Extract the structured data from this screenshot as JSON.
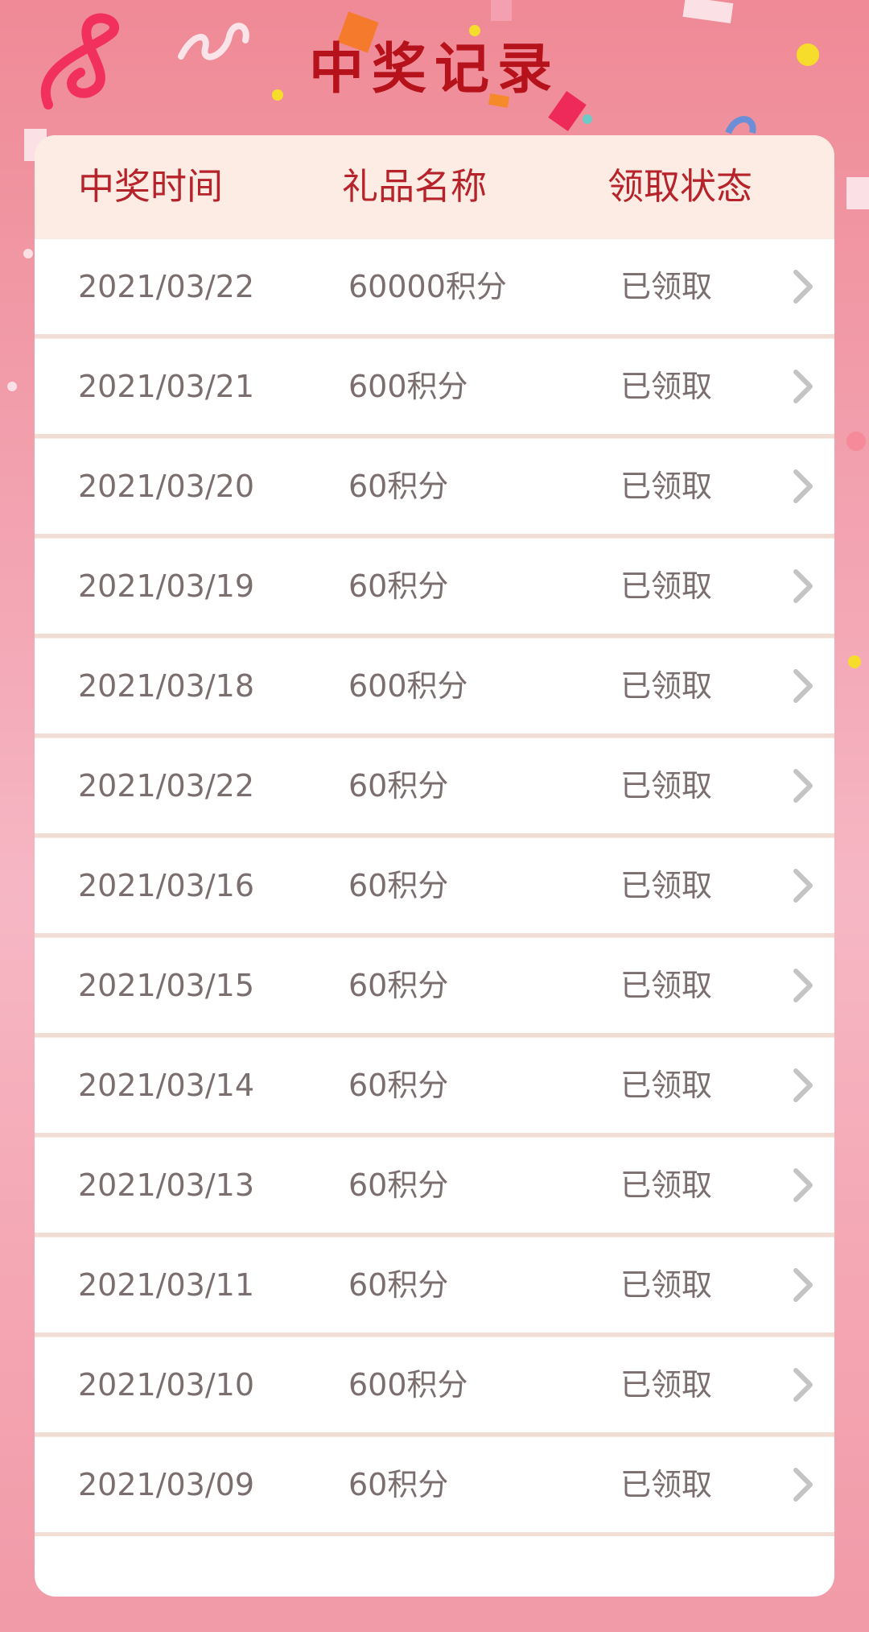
{
  "page": {
    "title": "中奖记录"
  },
  "table": {
    "headers": {
      "time": "中奖时间",
      "gift": "礼品名称",
      "status": "领取状态"
    },
    "rows": [
      {
        "date": "2021/03/22",
        "gift": "60000积分",
        "status": "已领取"
      },
      {
        "date": "2021/03/21",
        "gift": "600积分",
        "status": "已领取"
      },
      {
        "date": "2021/03/20",
        "gift": "60积分",
        "status": "已领取"
      },
      {
        "date": "2021/03/19",
        "gift": "60积分",
        "status": "已领取"
      },
      {
        "date": "2021/03/18",
        "gift": "600积分",
        "status": "已领取"
      },
      {
        "date": "2021/03/22",
        "gift": "60积分",
        "status": "已领取"
      },
      {
        "date": "2021/03/16",
        "gift": "60积分",
        "status": "已领取"
      },
      {
        "date": "2021/03/15",
        "gift": "60积分",
        "status": "已领取"
      },
      {
        "date": "2021/03/14",
        "gift": "60积分",
        "status": "已领取"
      },
      {
        "date": "2021/03/13",
        "gift": "60积分",
        "status": "已领取"
      },
      {
        "date": "2021/03/11",
        "gift": "60积分",
        "status": "已领取"
      },
      {
        "date": "2021/03/10",
        "gift": "600积分",
        "status": "已领取"
      },
      {
        "date": "2021/03/09",
        "gift": "60积分",
        "status": "已领取"
      }
    ]
  },
  "theme": {
    "title_color": "#b5121b",
    "header_bg": "#fdece3",
    "header_text": "#b6232a",
    "row_text": "#7b6e6e",
    "page_bg": "#f3a5b3"
  },
  "icons": {
    "row_chevron": "chevron-right-icon"
  }
}
